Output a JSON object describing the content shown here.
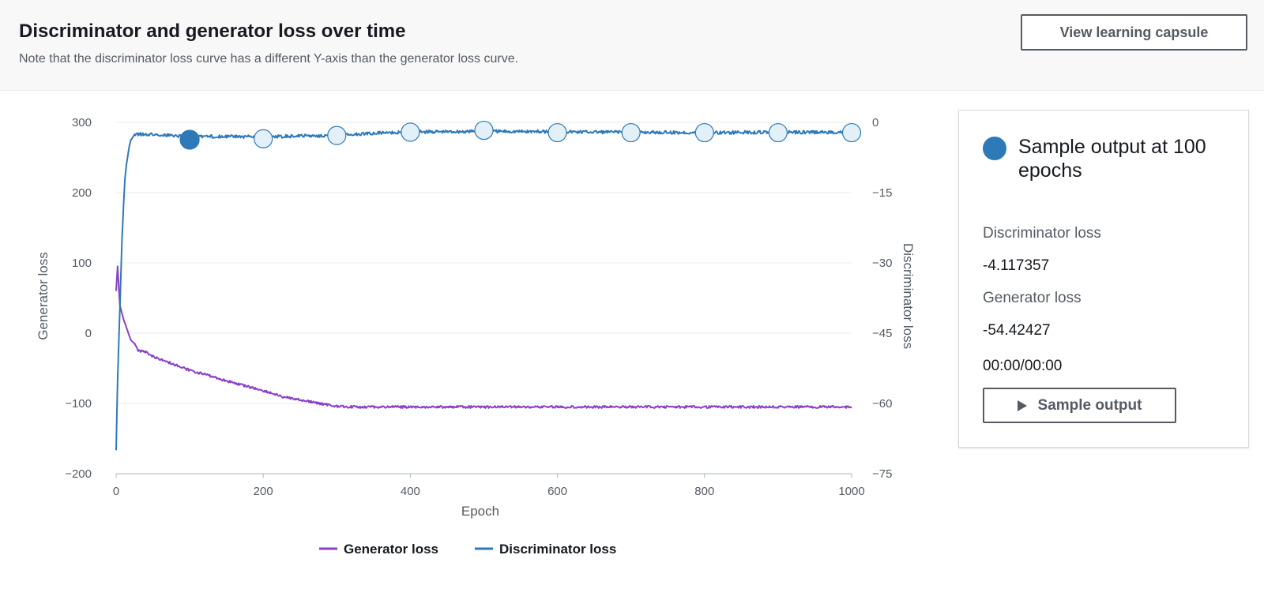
{
  "header": {
    "title": "Discriminator and generator loss over time",
    "subtitle": "Note that the discriminator loss curve has a different Y-axis than the generator loss curve.",
    "capsule_button": "View learning capsule"
  },
  "panel": {
    "heading": "Sample output at 100 epochs",
    "disc_label": "Discriminator loss",
    "disc_value": "-4.117357",
    "gen_label": "Generator loss",
    "gen_value": "-54.42427",
    "time": "00:00/00:00",
    "button": "Sample output",
    "accent_color": "#2e7ab8"
  },
  "chart_data": {
    "type": "line",
    "xlabel": "Epoch",
    "ylabel": "Generator loss",
    "y2label": "Discriminator loss",
    "xlim": [
      0,
      1000
    ],
    "ylim": [
      -200,
      300
    ],
    "y2lim": [
      -75,
      0
    ],
    "xticks": [
      0,
      200,
      400,
      600,
      800,
      1000
    ],
    "yticks": [
      -200,
      -100,
      0,
      100,
      200,
      300
    ],
    "y2ticks": [
      -75,
      -60,
      -45,
      -30,
      -15,
      0
    ],
    "grid": true,
    "legend_position": "bottom",
    "series": [
      {
        "name": "Generator loss",
        "axis": "left",
        "color": "#8c3fc4",
        "x": [
          0,
          2,
          5,
          10,
          15,
          20,
          25,
          30,
          40,
          50,
          75,
          100,
          125,
          150,
          175,
          200,
          225,
          250,
          275,
          300,
          325,
          350,
          400,
          500,
          600,
          700,
          800,
          900,
          1000
        ],
        "y": [
          60,
          95,
          40,
          20,
          5,
          -10,
          -15,
          -25,
          -27,
          -33,
          -43,
          -53,
          -60,
          -68,
          -75,
          -82,
          -90,
          -95,
          -100,
          -104,
          -105,
          -105,
          -105,
          -105,
          -105,
          -105,
          -105,
          -105,
          -105
        ]
      },
      {
        "name": "Discriminator loss",
        "axis": "right",
        "color": "#2e7ab8",
        "x": [
          0,
          2,
          4,
          6,
          8,
          10,
          12,
          14,
          16,
          18,
          20,
          25,
          30,
          50,
          75,
          100,
          150,
          200,
          250,
          300,
          350,
          400,
          450,
          500,
          600,
          700,
          800,
          900,
          1000
        ],
        "y": [
          -70,
          -55,
          -45,
          -35,
          -25,
          -18,
          -12,
          -9,
          -7,
          -5,
          -3.8,
          -2.6,
          -2.5,
          -2.6,
          -2.8,
          -3,
          -3,
          -3.1,
          -2.9,
          -2.8,
          -2.3,
          -2,
          -2,
          -1.9,
          -2,
          -2.1,
          -2.2,
          -2.1,
          -2.1
        ]
      }
    ],
    "sample_markers": {
      "epochs": [
        100,
        200,
        300,
        400,
        500,
        600,
        700,
        800,
        900,
        1000
      ],
      "values": [
        -3.7,
        -3.5,
        -2.8,
        -2.1,
        -1.7,
        -2.2,
        -2.2,
        -2.2,
        -2.2,
        -2.2
      ],
      "selected_epoch": 100,
      "fill": "#e3f0f8",
      "selected_fill": "#2e7ab8"
    }
  }
}
